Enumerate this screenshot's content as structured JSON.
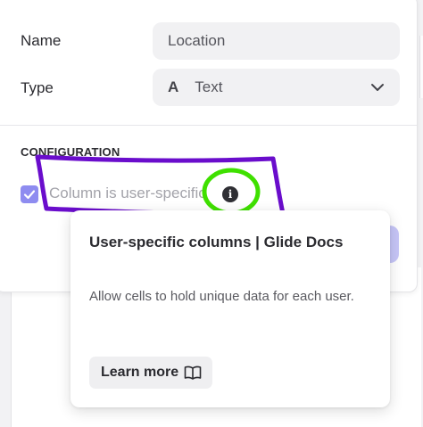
{
  "form": {
    "name_label": "Name",
    "name_value": "Location",
    "type_label": "Type",
    "type_icon_glyph": "A",
    "type_value": "Text"
  },
  "configuration": {
    "section_title": "CONFIGURATION",
    "user_specific_label": "Column is user-specific",
    "user_specific_checked": true
  },
  "tooltip": {
    "title": "User-specific columns | Glide Docs",
    "description": "Allow cells to hold unique data for each user.",
    "learn_more_label": "Learn more"
  },
  "colors": {
    "accent": "#8e8cf0",
    "annotation_purple": "#6a0dcc",
    "annotation_green": "#3fe000"
  },
  "icons": {
    "type": "text-type-icon",
    "dropdown": "chevron-down-icon",
    "info": "info-icon",
    "learn_more": "book-icon",
    "checkbox": "checkmark-icon"
  }
}
